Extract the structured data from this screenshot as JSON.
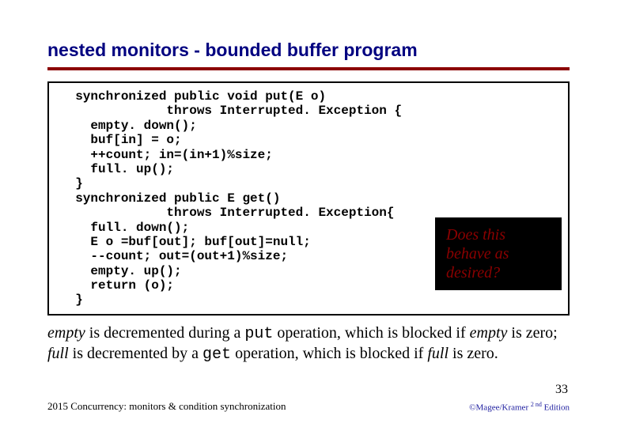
{
  "title": "nested monitors -  bounded buffer program",
  "code": "  synchronized public void put(E o)\n              throws Interrupted. Exception {\n    empty. down();\n    buf[in] = o;\n    ++count; in=(in+1)%size;\n    full. up();\n  }\n  synchronized public E get()\n              throws Interrupted. Exception{\n    full. down();\n    E o =buf[out]; buf[out]=null;\n    --count; out=(out+1)%size;\n    empty. up();\n    return (o);\n  }",
  "highlight": {
    "line1": "Does this behave",
    "line2": "as desired?"
  },
  "body": {
    "t1": "empty",
    "t2": " is decremented during a ",
    "t3": "put",
    "t4": " operation, which is blocked if ",
    "t5": "empty",
    "t6": " is zero; ",
    "t7": "full",
    "t8": " is decremented by a ",
    "t9": "get",
    "t10": " operation, which is blocked if ",
    "t11": "full",
    "t12": " is zero."
  },
  "pageNumber": "33",
  "footerLeft": "2015  Concurrency: monitors & condition synchronization",
  "footerRight": {
    "pre": "©Magee/Kramer ",
    "sup": "2 nd",
    "post": " Edition"
  }
}
